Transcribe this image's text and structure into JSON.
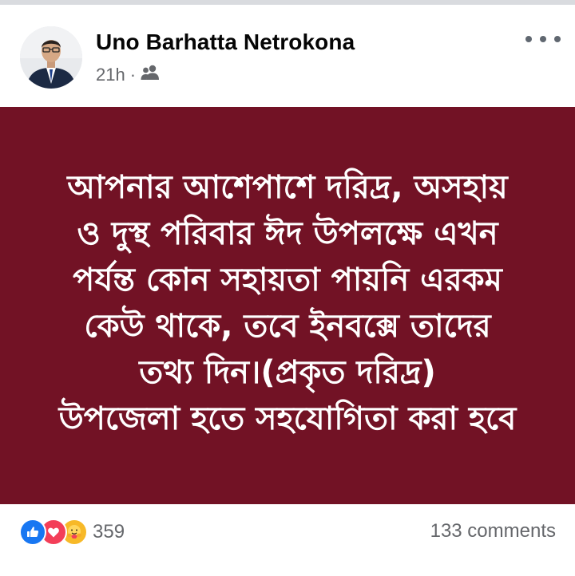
{
  "post": {
    "author": "Uno Barhatta Netrokona",
    "time": "21h",
    "separator": "·",
    "audience_icon": "friends-icon",
    "text_lines": [
      "আপনার আশেপাশে দরিদ্র, অসহায়",
      "ও দুস্থ পরিবার ঈদ উপলক্ষে এখন",
      "পর্যন্ত কোন সহায়তা পায়নি এরকম",
      "কেউ থাকে, তবে ইনবক্সে তাদের",
      "তথ্য দিন।(প্রকৃত দরিদ্র)",
      "উপজেলা হতে সহযোগিতা করা হবে"
    ],
    "background_color": "#721225",
    "text_color": "#ffffff"
  },
  "footer": {
    "reaction_icons": [
      "like-icon",
      "love-icon",
      "care-icon"
    ],
    "reaction_count": "359",
    "comments": "133 comments"
  },
  "colors": {
    "like": "#1877f2",
    "love": "#f33e58",
    "care": "#f7b928",
    "meta_text": "#65676b"
  }
}
